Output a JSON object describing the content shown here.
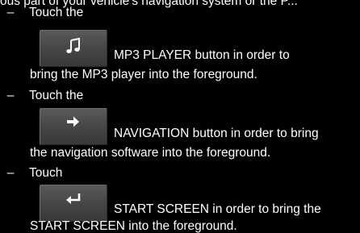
{
  "top_cut_text": "ous part of your vehicle's navigation system or the P...",
  "items": [
    {
      "dash": "–",
      "intro": "Touch the",
      "icon": "music-note-icon",
      "line1": "MP3 PLAYER button in order to",
      "line2": "bring the MP3 player into the foreground."
    },
    {
      "dash": "–",
      "intro": "Touch the",
      "icon": "arrow-right-icon",
      "line1": "NAVIGATION button in order to bring",
      "line2": "the navigation software into the foreground."
    },
    {
      "dash": "–",
      "intro": "Touch",
      "icon": "return-arrow-icon",
      "line1": "START SCREEN in order to bring the",
      "line2": "START SCREEN into the foreground."
    }
  ]
}
